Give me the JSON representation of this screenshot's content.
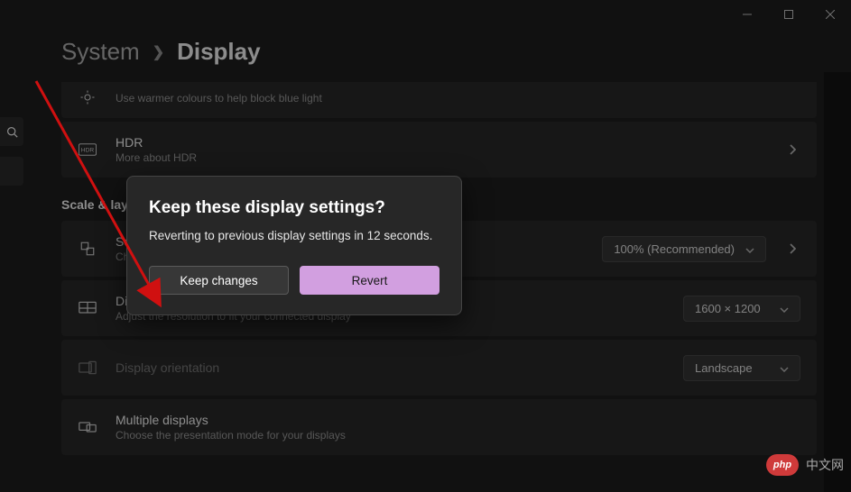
{
  "breadcrumb": {
    "parent": "System",
    "current": "Display"
  },
  "night_light": {
    "subtitle": "Use warmer colours to help block blue light"
  },
  "hdr": {
    "title": "HDR",
    "subtitle": "More about HDR"
  },
  "section_scale": "Scale & layout",
  "scale": {
    "title": "Scale",
    "subtitle": "Change the size of text, apps and other items",
    "value": "100% (Recommended)"
  },
  "resolution": {
    "title": "Display resolution",
    "subtitle": "Adjust the resolution to fit your connected display",
    "value": "1600 × 1200"
  },
  "orientation": {
    "title": "Display orientation",
    "value": "Landscape"
  },
  "multi": {
    "title": "Multiple displays",
    "subtitle": "Choose the presentation mode for your displays"
  },
  "dialog": {
    "title": "Keep these display settings?",
    "body": "Reverting to previous display settings in 12 seconds.",
    "keep": "Keep changes",
    "revert": "Revert"
  },
  "watermark": {
    "text": "中文网",
    "badge": "php"
  }
}
